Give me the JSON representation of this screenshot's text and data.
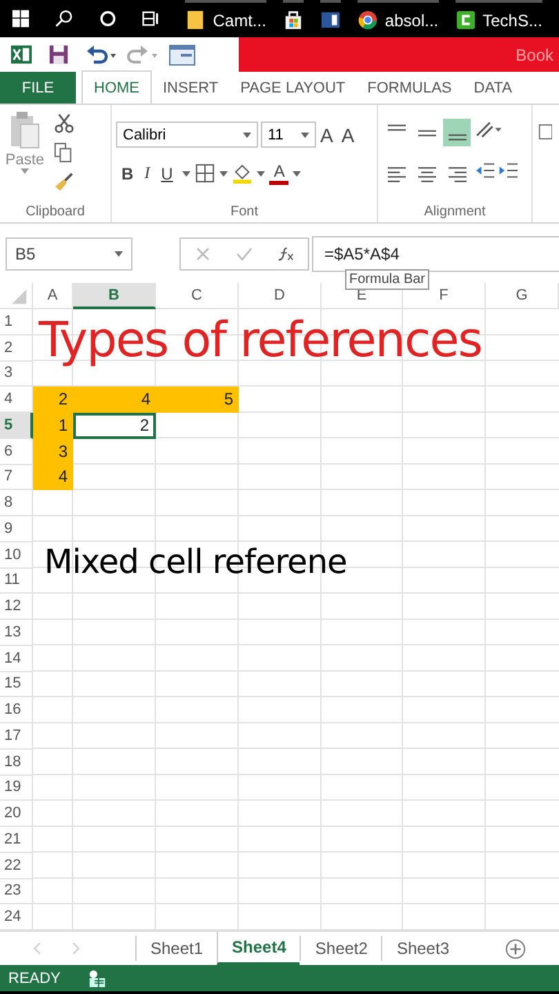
{
  "taskbar": {
    "apps": [
      {
        "kind": "folder",
        "label": "Camt..."
      },
      {
        "kind": "store"
      },
      {
        "kind": "word"
      },
      {
        "kind": "chrome",
        "label": "absol..."
      },
      {
        "kind": "camtasia",
        "label": "TechS..."
      }
    ]
  },
  "title_bar": {
    "title": "Book"
  },
  "ribbon_tabs": [
    {
      "label": "FILE",
      "kind": "file",
      "selected": false
    },
    {
      "label": "HOME",
      "kind": "tab",
      "selected": true
    },
    {
      "label": "INSERT",
      "kind": "tab",
      "selected": false
    },
    {
      "label": "PAGE LAYOUT",
      "kind": "tab",
      "selected": false
    },
    {
      "label": "FORMULAS",
      "kind": "tab",
      "selected": false
    },
    {
      "label": "DATA",
      "kind": "tab",
      "selected": false
    }
  ],
  "ribbon": {
    "clipboard": {
      "paste_label": "Paste",
      "group_label": "Clipboard"
    },
    "font": {
      "font_name": "Calibri",
      "font_size": "11",
      "size_buttons": [
        "A",
        "A"
      ],
      "format_buttons": [
        "B",
        "I",
        "U"
      ],
      "font_color_label": "A",
      "group_label": "Font"
    },
    "alignment": {
      "buttons": [
        {
          "kind": "top",
          "selected": false
        },
        {
          "kind": "middle",
          "selected": false
        },
        {
          "kind": "bottom",
          "selected": true
        },
        {
          "kind": "left",
          "selected": false
        },
        {
          "kind": "center",
          "selected": false
        },
        {
          "kind": "right",
          "selected": false
        }
      ],
      "group_label": "Alignment"
    }
  },
  "formula_bar": {
    "name_box": "B5",
    "formula": "=$A5*A$4",
    "tooltip": "Formula Bar"
  },
  "sheet": {
    "columns": [
      {
        "label": "A",
        "selected": false
      },
      {
        "label": "B",
        "selected": true
      },
      {
        "label": "C",
        "selected": false
      },
      {
        "label": "D",
        "selected": false
      },
      {
        "label": "E",
        "selected": false
      },
      {
        "label": "F",
        "selected": false
      },
      {
        "label": "G",
        "selected": false
      }
    ],
    "rows": [
      {
        "label": "1",
        "selected": false
      },
      {
        "label": "2",
        "selected": false
      },
      {
        "label": "3",
        "selected": false
      },
      {
        "label": "4",
        "selected": false,
        "cells": [
          {
            "value": "2",
            "highlighted": true,
            "selected": false
          },
          {
            "value": "4",
            "highlighted": true,
            "selected": false
          },
          {
            "value": "5",
            "highlighted": true,
            "selected": false
          }
        ]
      },
      {
        "label": "5",
        "selected": true,
        "cells": [
          {
            "value": "1",
            "highlighted": true,
            "selected": false
          },
          {
            "value": "2",
            "highlighted": false,
            "selected": true
          }
        ]
      },
      {
        "label": "6",
        "selected": false,
        "cells": [
          {
            "value": "3",
            "highlighted": true,
            "selected": false
          }
        ]
      },
      {
        "label": "7",
        "selected": false,
        "cells": [
          {
            "value": "4",
            "highlighted": true,
            "selected": false
          }
        ]
      },
      {
        "label": "8",
        "selected": false
      },
      {
        "label": "9",
        "selected": false
      },
      {
        "label": "10",
        "selected": false
      },
      {
        "label": "11",
        "selected": false
      },
      {
        "label": "12",
        "selected": false
      },
      {
        "label": "13",
        "selected": false
      },
      {
        "label": "14",
        "selected": false
      },
      {
        "label": "15",
        "selected": false
      },
      {
        "label": "16",
        "selected": false
      },
      {
        "label": "17",
        "selected": false
      },
      {
        "label": "18",
        "selected": false
      },
      {
        "label": "19",
        "selected": false
      },
      {
        "label": "20",
        "selected": false
      },
      {
        "label": "21",
        "selected": false
      },
      {
        "label": "22",
        "selected": false
      },
      {
        "label": "23",
        "selected": false
      },
      {
        "label": "24",
        "selected": false
      }
    ],
    "overlay_texts": [
      {
        "kind": "title",
        "text": "Types of references"
      },
      {
        "kind": "caption",
        "text": "Mixed cell referene"
      }
    ]
  },
  "sheet_tabs": [
    {
      "label": "Sheet1",
      "selected": false
    },
    {
      "label": "Sheet4",
      "selected": true
    },
    {
      "label": "Sheet2",
      "selected": false
    },
    {
      "label": "Sheet3",
      "selected": false
    }
  ],
  "status_bar": {
    "status": "READY"
  }
}
